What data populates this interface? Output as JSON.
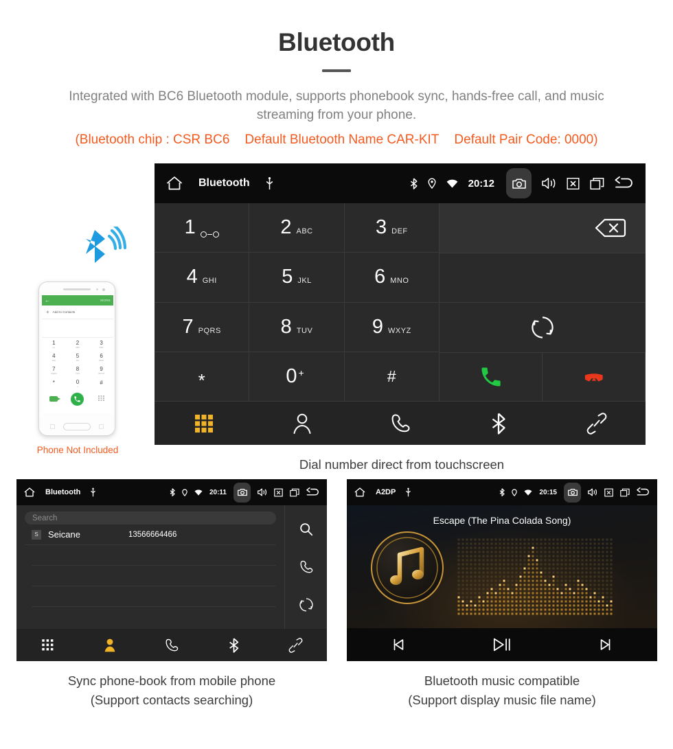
{
  "hero": {
    "title": "Bluetooth",
    "description": "Integrated with BC6 Bluetooth module, supports phonebook sync, hands-free call, and music streaming from your phone.",
    "spec_chip": "(Bluetooth chip : CSR BC6",
    "spec_name": "Default Bluetooth Name CAR-KIT",
    "spec_pair": "Default Pair Code: 0000)",
    "accent_color": "#f4591e",
    "text_color": "#808080"
  },
  "dial_screen": {
    "statusbar": {
      "title": "Bluetooth",
      "time": "20:12",
      "icons": [
        "home-icon",
        "usb-icon",
        "bluetooth-icon",
        "location-icon",
        "wifi-icon",
        "camera-icon",
        "volume-icon",
        "close-icon",
        "recents-icon",
        "back-icon"
      ]
    },
    "keys": [
      {
        "digit": "1",
        "sub": "",
        "icon": "voicemail-icon"
      },
      {
        "digit": "2",
        "sub": "ABC",
        "icon": ""
      },
      {
        "digit": "3",
        "sub": "DEF",
        "icon": ""
      },
      {
        "digit": "4",
        "sub": "GHI",
        "icon": ""
      },
      {
        "digit": "5",
        "sub": "JKL",
        "icon": ""
      },
      {
        "digit": "6",
        "sub": "MNO",
        "icon": ""
      },
      {
        "digit": "7",
        "sub": "PQRS",
        "icon": ""
      },
      {
        "digit": "8",
        "sub": "TUV",
        "icon": ""
      },
      {
        "digit": "9",
        "sub": "WXYZ",
        "icon": ""
      },
      {
        "digit": "*",
        "sub": "",
        "icon": ""
      },
      {
        "digit": "0",
        "sub": "+",
        "icon": ""
      },
      {
        "digit": "#",
        "sub": "",
        "icon": ""
      }
    ],
    "number_display": "",
    "backspace_icon": "backspace-icon",
    "sync_icon": "sync-icon",
    "call_icon": "call-answer-icon",
    "hangup_icon": "call-end-icon",
    "call_color": "#22c943",
    "hangup_color": "#e8371c",
    "tabs": [
      {
        "name": "keypad",
        "icon": "keypad-grid-icon",
        "active": true
      },
      {
        "name": "contacts",
        "icon": "person-icon",
        "active": false
      },
      {
        "name": "call-log",
        "icon": "handset-icon",
        "active": false
      },
      {
        "name": "bluetooth",
        "icon": "bluetooth-icon",
        "active": false
      },
      {
        "name": "pair-link",
        "icon": "link-icon",
        "active": false
      }
    ],
    "active_tab_color": "#f0b429",
    "caption": "Dial number direct from touchscreen"
  },
  "phone_mock": {
    "app_bar_more": "MORE",
    "add_to_contacts": "Add to Contacts",
    "keys": [
      {
        "digit": "1",
        "sub": "oo"
      },
      {
        "digit": "2",
        "sub": "ABC"
      },
      {
        "digit": "3",
        "sub": "DEF"
      },
      {
        "digit": "4",
        "sub": "GHI"
      },
      {
        "digit": "5",
        "sub": "JKL"
      },
      {
        "digit": "6",
        "sub": "MNO"
      },
      {
        "digit": "7",
        "sub": "PQRS"
      },
      {
        "digit": "8",
        "sub": "TUV"
      },
      {
        "digit": "9",
        "sub": "WXYZ"
      },
      {
        "digit": "*",
        "sub": ""
      },
      {
        "digit": "0",
        "sub": "+"
      },
      {
        "digit": "#",
        "sub": ""
      }
    ],
    "caption": "Phone Not Included",
    "caption_color": "#f4591e",
    "bluetooth_wave_color": "#1e9be0",
    "app_accent": "#4caf50"
  },
  "phonebook_screen": {
    "statusbar": {
      "title": "Bluetooth",
      "time": "20:11"
    },
    "search_placeholder": "Search",
    "contacts": [
      {
        "initial": "S",
        "name": "Seicane",
        "number": "13566664466"
      }
    ],
    "side_actions": [
      {
        "name": "search",
        "icon": "search-icon"
      },
      {
        "name": "call",
        "icon": "handset-icon"
      },
      {
        "name": "sync",
        "icon": "sync-icon"
      }
    ],
    "tabs": [
      {
        "name": "keypad",
        "icon": "keypad-grid-icon",
        "active": false
      },
      {
        "name": "contacts",
        "icon": "person-icon",
        "active": true
      },
      {
        "name": "call-log",
        "icon": "handset-icon",
        "active": false
      },
      {
        "name": "bluetooth",
        "icon": "bluetooth-icon",
        "active": false
      },
      {
        "name": "pair-link",
        "icon": "link-icon",
        "active": false
      }
    ],
    "active_tab_color": "#f0b429",
    "caption_line1": "Sync phone-book from mobile phone",
    "caption_line2": "(Support contacts searching)"
  },
  "a2dp_screen": {
    "statusbar": {
      "title": "A2DP",
      "time": "20:15"
    },
    "track_title": "Escape (The Pina Colada Song)",
    "controls": [
      {
        "name": "previous",
        "icon": "skip-previous-icon"
      },
      {
        "name": "play-pause",
        "icon": "play-pause-icon"
      },
      {
        "name": "next",
        "icon": "skip-next-icon"
      }
    ],
    "album_icon": "music-note-bluetooth-icon",
    "accent_color": "#d9a13b",
    "caption_line1": "Bluetooth music compatible",
    "caption_line2": "(Support display music file name)"
  }
}
